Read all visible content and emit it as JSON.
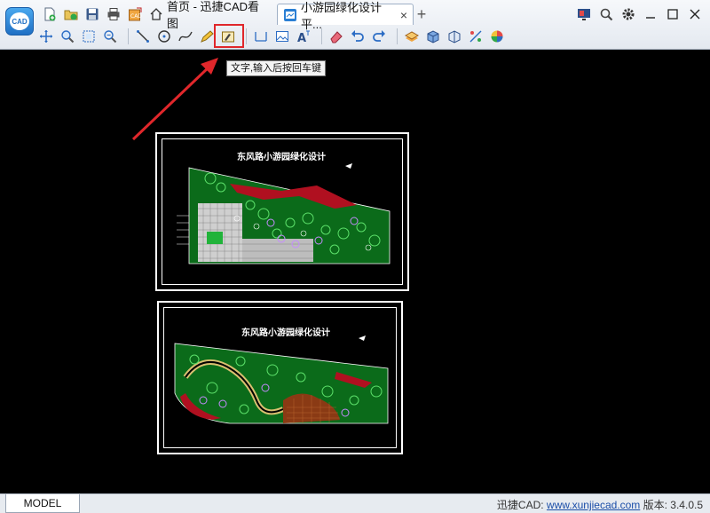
{
  "app": {
    "logo_text": "CAD"
  },
  "tabs": {
    "home_label": "首页 - 迅捷CAD看图",
    "doc_label": "小游园绿化设计平...",
    "close": "×",
    "add": "+"
  },
  "toolbar_row1": [
    "new-file-icon",
    "open-file-icon",
    "save-icon",
    "print-icon",
    "export-icon"
  ],
  "toolbar_row2": [
    "pan-icon",
    "zoom-icon",
    "zoom-window-icon",
    "zoom-extents-icon",
    "line-icon",
    "circle-icon",
    "curve-icon",
    "pencil-icon",
    "text-input-icon",
    "dimension-icon",
    "image-icon",
    "text-style-icon",
    "eraser-icon",
    "undo-icon",
    "redo-icon",
    "layer-icon",
    "3d-box-icon",
    "3d-view-icon",
    "settings-icon",
    "color-icon"
  ],
  "tooltip": {
    "text": "文字,输入后按回车键"
  },
  "drawing": {
    "sheet1_title": "东风路小游园绿化设计",
    "sheet2_title": "东风路小游园绿化设计"
  },
  "statusbar": {
    "model_tab": "MODEL",
    "brand_prefix": "迅捷CAD: ",
    "url": "www.xunjiecad.com",
    "version_text": " 版本: 3.4.0.5"
  },
  "colors": {
    "highlight": "#e0272b",
    "canvas": "#000000",
    "accent": "#1f6fc4"
  }
}
